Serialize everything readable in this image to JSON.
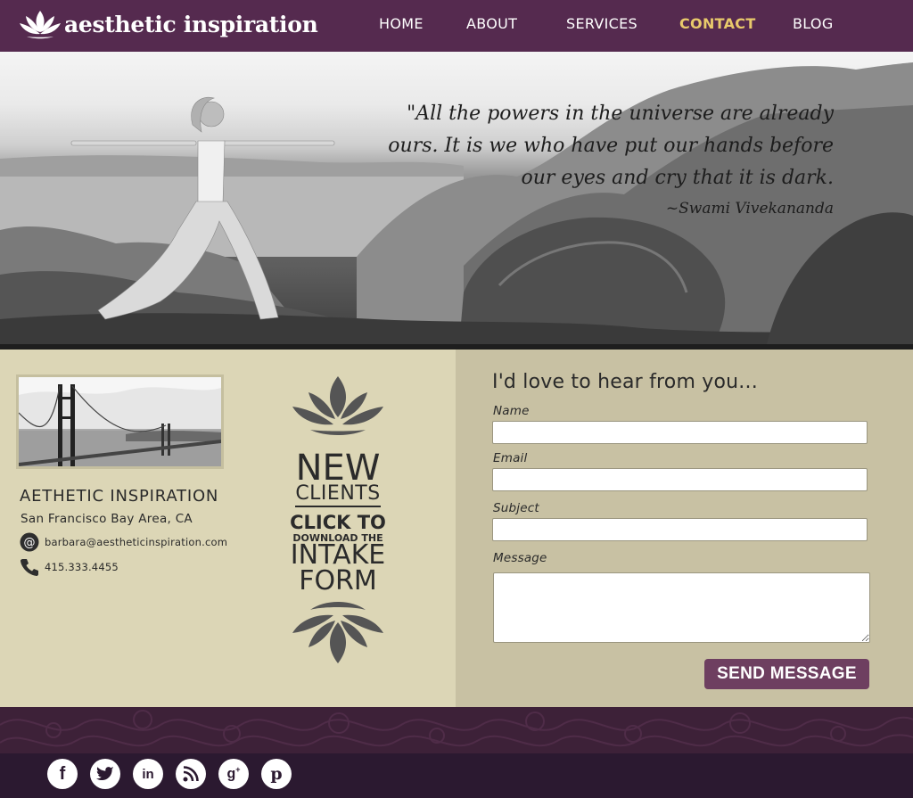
{
  "header": {
    "logo_text": "aesthetic inspiration",
    "nav": [
      {
        "label": "HOME",
        "active": false
      },
      {
        "label": "ABOUT",
        "active": false
      },
      {
        "label": "SERVICES",
        "active": false
      },
      {
        "label": "CONTACT",
        "active": true
      },
      {
        "label": "BLOG",
        "active": false
      }
    ]
  },
  "hero": {
    "quote_lines": [
      "\"All the powers in the universe are already",
      "ours. It is we who have put our hands before",
      "our eyes and cry that it is dark."
    ],
    "author": "~Swami Vivekananda"
  },
  "info": {
    "business_name": "AETHETIC INSPIRATION",
    "location": "San Francisco Bay Area, CA",
    "email": "barbara@aestheticinspiration.com",
    "phone": "415.333.4455"
  },
  "intake": {
    "line1": "NEW",
    "line2": "CLIENTS",
    "line3": "CLICK TO",
    "line4": "DOWNLOAD THE",
    "line5": "INTAKE",
    "line6": "FORM"
  },
  "form": {
    "title": "I'd love to hear from you...",
    "name_label": "Name",
    "email_label": "Email",
    "subject_label": "Subject",
    "message_label": "Message",
    "name_value": "",
    "email_value": "",
    "subject_value": "",
    "message_value": "",
    "send_label": "SEND MESSAGE"
  },
  "footer": {
    "social": [
      "facebook-icon",
      "twitter-icon",
      "linkedin-icon",
      "rss-icon",
      "google-plus-icon",
      "pinterest-icon"
    ]
  },
  "colors": {
    "header_bg": "#552a4f",
    "nav_active": "#e8c96b",
    "left_panel": "#dcd6b6",
    "right_panel": "#c8c1a3",
    "button": "#6e3f60",
    "footer": "#2b1930"
  }
}
